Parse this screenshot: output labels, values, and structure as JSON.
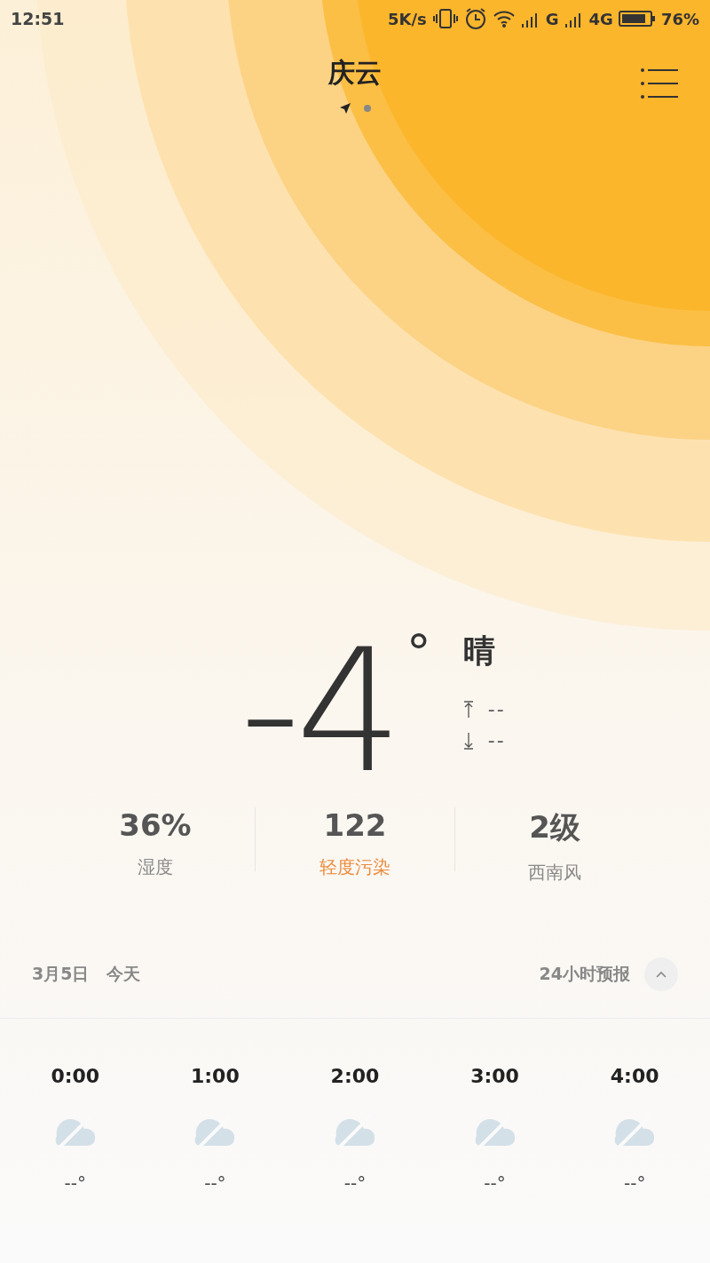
{
  "status_bar": {
    "time": "12:51",
    "speed": "5K/s",
    "network_sim1": "G",
    "network": "4G",
    "battery": "76%"
  },
  "header": {
    "city": "庆云",
    "pages": [
      {
        "kind": "location",
        "selected": true
      },
      {
        "kind": "dot",
        "selected": false
      }
    ]
  },
  "current": {
    "temperature": "-4",
    "degree": "°",
    "condition": "晴",
    "high": "--",
    "low": "--"
  },
  "stats": [
    {
      "value": "36%",
      "label": "湿度",
      "kind": "normal"
    },
    {
      "value": "122",
      "label": "轻度污染",
      "kind": "alert"
    },
    {
      "value": "2级",
      "label": "西南风",
      "kind": "normal"
    }
  ],
  "forecast_header": {
    "date": "3月5日",
    "day": "今天",
    "title": "24小时预报",
    "expanded": true
  },
  "hourly": [
    {
      "time": "0:00",
      "temp": "--°"
    },
    {
      "time": "1:00",
      "temp": "--°"
    },
    {
      "time": "2:00",
      "temp": "--°"
    },
    {
      "time": "3:00",
      "temp": "--°"
    },
    {
      "time": "4:00",
      "temp": "--°"
    }
  ]
}
